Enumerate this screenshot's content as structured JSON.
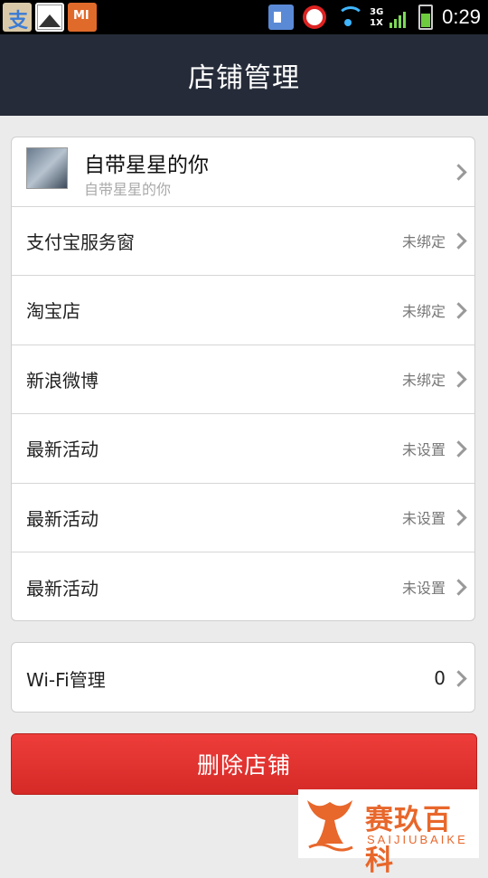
{
  "status_bar": {
    "time": "0:29",
    "network_top": "3G",
    "network_bottom": "1X",
    "notification_icons": [
      "alipay-icon",
      "gallery-icon",
      "mi-icon"
    ],
    "mi_label": "MI",
    "alipay_glyph": "支"
  },
  "header": {
    "title": "店铺管理"
  },
  "profile": {
    "name": "自带星星的你",
    "subtitle": "自带星星的你"
  },
  "bindings": [
    {
      "label": "支付宝服务窗",
      "status": "未绑定"
    },
    {
      "label": "淘宝店",
      "status": "未绑定"
    },
    {
      "label": "新浪微博",
      "status": "未绑定"
    },
    {
      "label": "最新活动",
      "status": "未设置"
    },
    {
      "label": "最新活动",
      "status": "未设置"
    },
    {
      "label": "最新活动",
      "status": "未设置"
    }
  ],
  "wifi": {
    "label": "Wi-Fi管理",
    "count": "0"
  },
  "actions": {
    "delete_label": "删除店铺"
  },
  "watermark": {
    "title": "赛玖百科",
    "subtitle": "SAIJIUBAIKE"
  },
  "colors": {
    "header_bg": "#252b38",
    "page_bg": "#ebebeb",
    "delete_button": "#e23331",
    "watermark_orange": "#e8672b"
  }
}
